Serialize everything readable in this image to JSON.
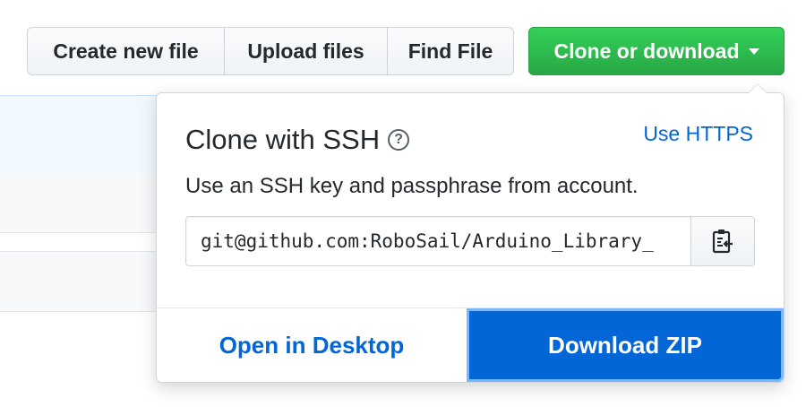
{
  "toolbar": {
    "create_new_file": "Create new file",
    "upload_files": "Upload files",
    "find_file": "Find File",
    "clone_or_download": "Clone or download"
  },
  "clone_panel": {
    "title": "Clone with SSH",
    "help_symbol": "?",
    "switch_protocol_link": "Use HTTPS",
    "description": "Use an SSH key and passphrase from account.",
    "clone_url_visible": "git@github.com:RoboSail/Arduino_Library_",
    "copy_icon": "clipboard-icon",
    "open_in_desktop": "Open in Desktop",
    "download_zip": "Download ZIP"
  },
  "colors": {
    "clone_button_green": "#28a745",
    "link_blue": "#0366d6",
    "download_zip_bg": "#0366d6"
  }
}
